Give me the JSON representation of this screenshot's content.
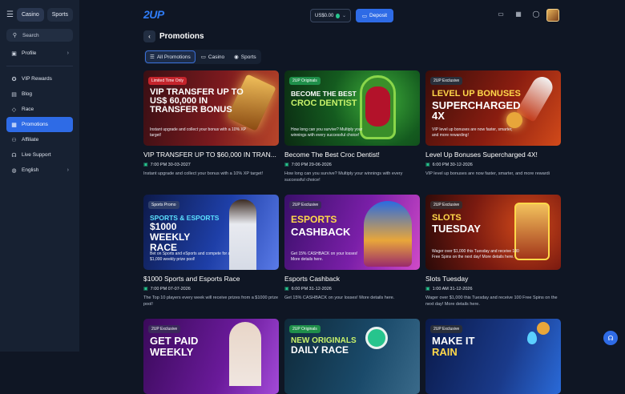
{
  "sidebar": {
    "tabs": [
      {
        "label": "Casino"
      },
      {
        "label": "Sports"
      }
    ],
    "search": {
      "label": "Search"
    },
    "profile": {
      "label": "Profile"
    },
    "items": [
      {
        "label": "VIP Rewards",
        "icon": "star-icon"
      },
      {
        "label": "Blog",
        "icon": "blog-icon"
      },
      {
        "label": "Race",
        "icon": "diamond-icon"
      },
      {
        "label": "Promotions",
        "icon": "gift-icon"
      },
      {
        "label": "Affiliate",
        "icon": "users-icon"
      },
      {
        "label": "Live Support",
        "icon": "headset-icon"
      },
      {
        "label": "English",
        "icon": "globe-icon"
      }
    ]
  },
  "header": {
    "logo": "2UP",
    "wallet": {
      "amount": "US$0.00"
    },
    "deposit_label": "Deposit"
  },
  "page": {
    "title": "Promotions",
    "tabs": [
      {
        "label": "All Promotions"
      },
      {
        "label": "Casino"
      },
      {
        "label": "Sports"
      }
    ]
  },
  "promotions": [
    {
      "badge": "Limited Time Only",
      "headline": "VIP TRANSFER UP TO US$ 60,000 IN TRANSFER BONUS",
      "banner_text": "Instant upgrade and collect your bonus with a 10% XP target!",
      "title": "VIP TRANSFER UP TO $60,000 IN TRAN...",
      "date": "7:00 PM 30-03-2027",
      "desc": "Instant upgrade and collect your bonus with a 10% XP target!"
    },
    {
      "badge": "2UP Originals",
      "headline": "BECOME THE BEST",
      "headline2": "CROC DENTIST",
      "banner_text": "How long can you survive? Multiply your winnings with every successful choice!",
      "title": "Become The Best Croc Dentist!",
      "date": "7:00 PM 29-06-2026",
      "desc": "How long can you survive? Multiply your winnings with every successful choice!"
    },
    {
      "badge": "2UP Exclusive",
      "headline": "LEVEL UP BONUSES",
      "headline2": "SUPERCHARGED 4X",
      "banner_text": "VIP level up bonuses are now faster, smarter, and more rewarding!",
      "title": "Level Up Bonuses Supercharged 4X!",
      "date": "6:00 PM 30-12-2026",
      "desc": "VIP level up bonuses are now faster, smarter, and more rewardi"
    },
    {
      "badge": "Sports Promo",
      "headline": "SPORTS & ESPORTS",
      "headline2": "$1000 WEEKLY RACE",
      "banner_text": "Bet on Sports and eSports and compete for a $1,000 weekly prize pool!",
      "title": "$1000 Sports and Esports Race",
      "date": "7:00 PM 07-07-2026",
      "desc": "The Top 10 players every week will receive prizes from a $1000 prize pool!"
    },
    {
      "badge": "2UP Exclusive",
      "headline": "ESPORTS",
      "headline2": "CASHBACK",
      "banner_text": "Get 15% CASHBACK on your losses! More details here.",
      "title": "Esports Cashback",
      "date": "6:00 PM 31-12-2026",
      "desc": "Get 15% CASHBACK on your losses! More details here."
    },
    {
      "badge": "2UP Exclusive",
      "headline": "SLOTS",
      "headline2": "TUESDAY",
      "banner_text": "Wager over $1,000 this Tuesday and receive 100 Free Spins on the next day! More details here.",
      "title": "Slots Tuesday",
      "date": "1:00 AM 31-12-2026",
      "desc": "Wager over $1,000 this Tuesday and receive 100 Free Spins on the next day! More details here."
    },
    {
      "badge": "2UP Exclusive",
      "headline": "GET PAID",
      "headline2": "WEEKLY"
    },
    {
      "badge": "2UP Originals",
      "headline": "NEW ORIGINALS",
      "headline2": "DAILY RACE"
    },
    {
      "badge": "2UP Exclusive",
      "headline": "MAKE IT",
      "headline2": "RAIN"
    }
  ],
  "colors": {
    "accent": "#2e6be6",
    "brand": "#2f7cf6",
    "background": "#0f1624",
    "sidebar": "#172132"
  }
}
